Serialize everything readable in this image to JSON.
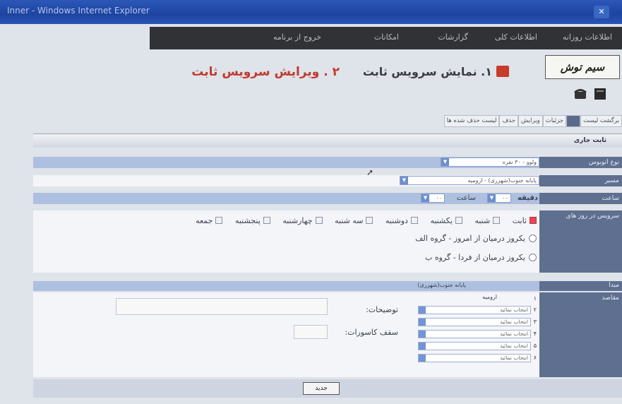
{
  "window": {
    "title": "Inner - Windows Internet Explorer",
    "close_label": "✕"
  },
  "menu": {
    "items": [
      "اطلاعات روزانه",
      "اطلاعات کلی",
      "گزارشات",
      "امکانات",
      "خروج از برنامه"
    ]
  },
  "logo": {
    "text": "سیم توش"
  },
  "headings": {
    "show_fixed": "۱. نمایش سرویس ثابت",
    "edit_fixed": "۲ . ویرایش سرویس ثابت"
  },
  "tabs": [
    "برگشت لیست",
    "",
    "جزئیات",
    "ویرایش",
    "حذف",
    "لیست حذف شده ها"
  ],
  "section": {
    "title": "ثابت جاری"
  },
  "form": {
    "vehicle_label": "نوع اتوبوس",
    "vehicle_value": "ولوو - ۳۰ نفره",
    "direction_label": "مسیر",
    "direction_value": "پایانه جنوب(شهرری) - ارومیه",
    "time_label": "ساعت",
    "minute_label": "دقیقه",
    "hour_label": "ساعت",
    "minute_value": "۰۰",
    "hour_value": "۰۰",
    "days_label": "سرویس در روز های",
    "days": [
      "ثابت",
      "شنبه",
      "یکشنبه",
      "دوشنبه",
      "سه شنبه",
      "چهارشنبه",
      "پنجشنبه",
      "جمعه"
    ],
    "radio1": "یکروز درمیان از امروز - گروه الف",
    "radio2": "یکروز درمیان از فردا - گروه ب",
    "origin_label": "مبدا",
    "origin_value": "پایانه جنوب(شهرری)",
    "dest_label": "مقاصد",
    "destinations": [
      "ارومیه",
      "انتخاب نمائید",
      "انتخاب نمائید",
      "انتخاب نمائید",
      "انتخاب نمائید",
      "انتخاب نمائید"
    ],
    "dest_numbers": [
      "۱",
      "۲",
      "۳",
      "۴",
      "۵",
      "۶"
    ],
    "description_label": "توضیحات:",
    "quota_label": "سقف کاسورات:",
    "submit_label": "جدید"
  }
}
